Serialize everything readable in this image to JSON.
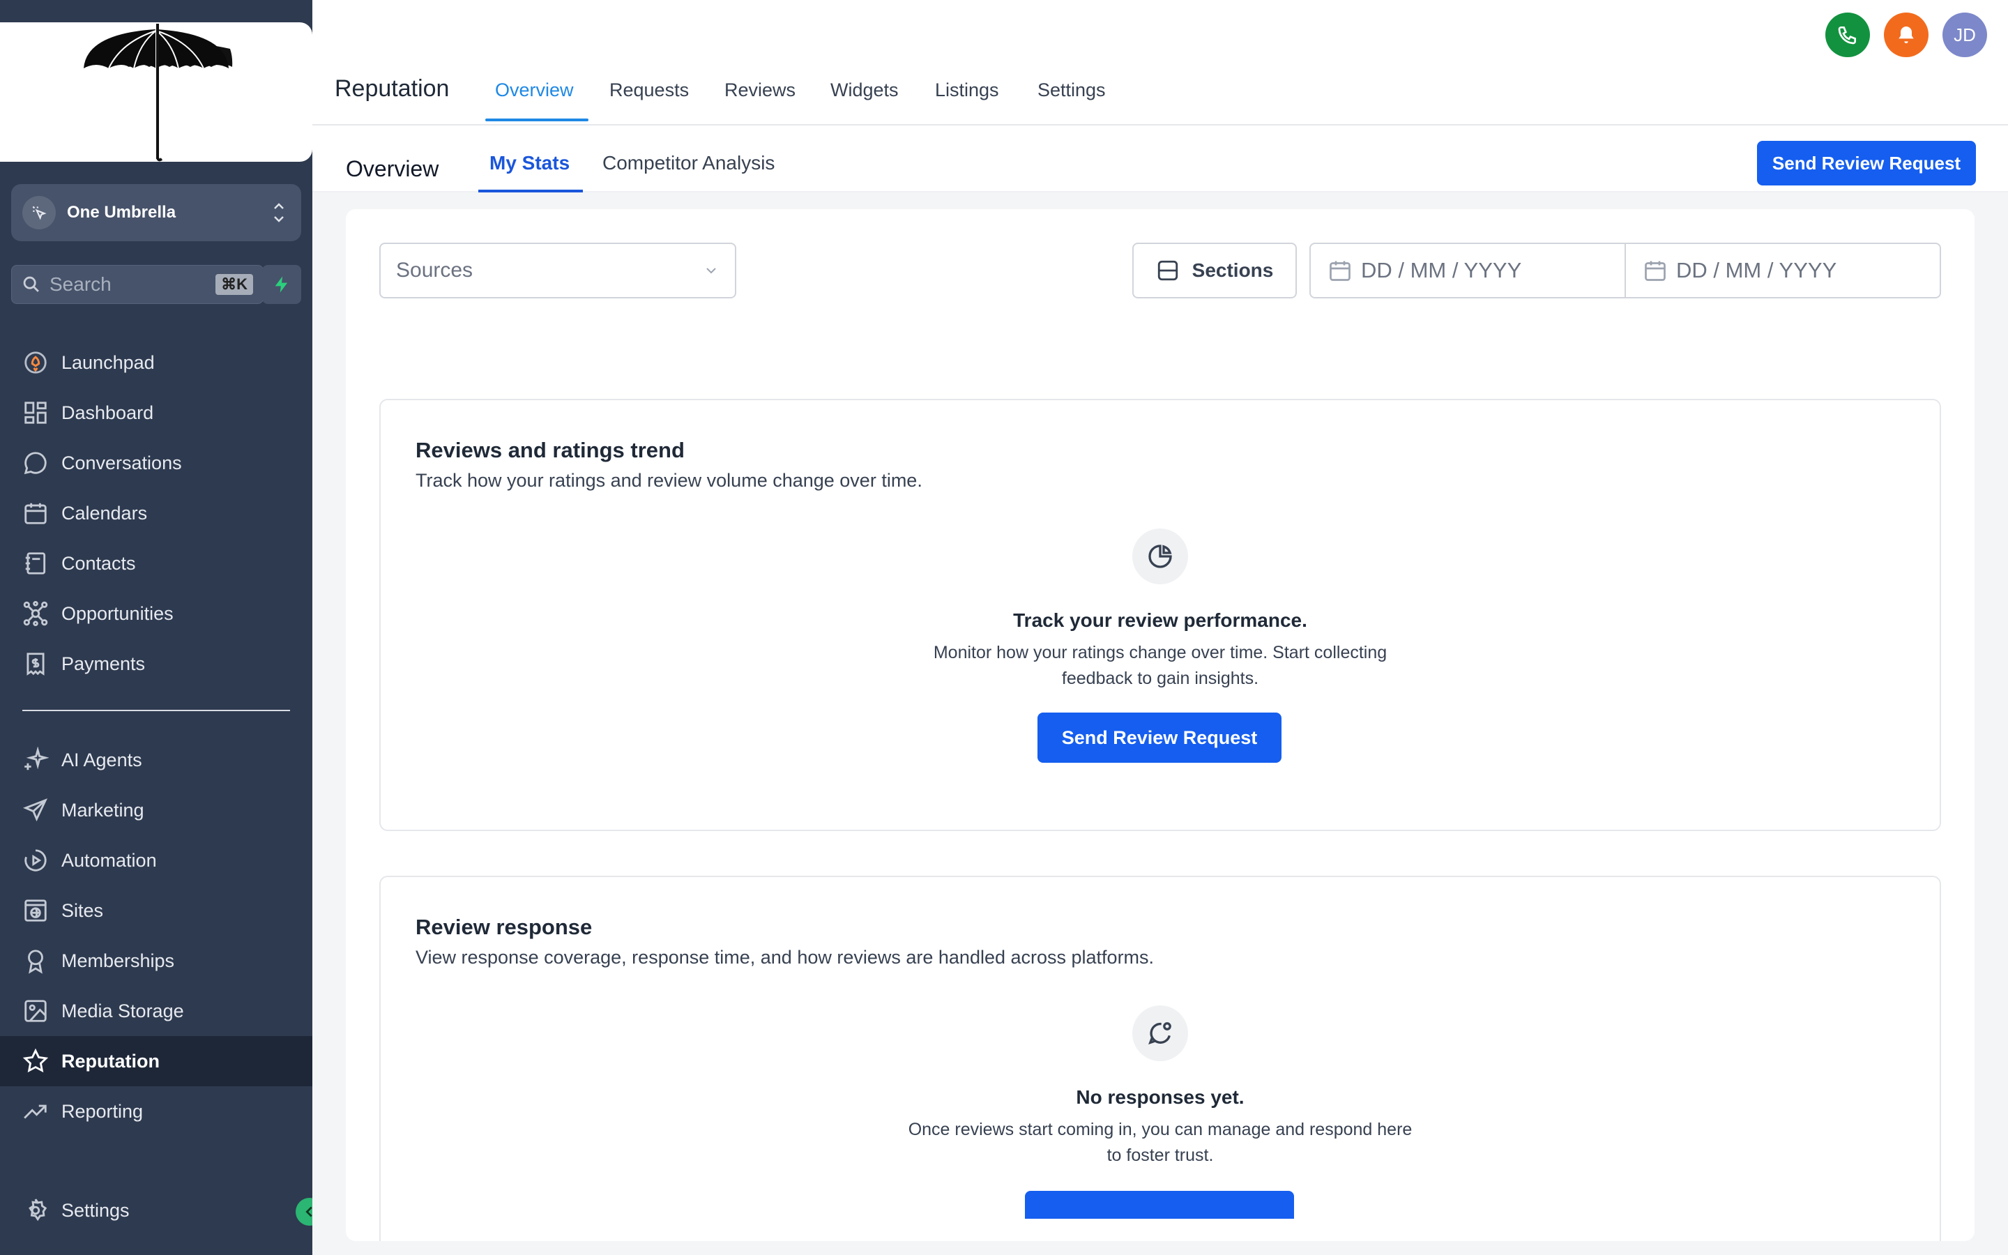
{
  "sidebar": {
    "account": {
      "name": "One Umbrella"
    },
    "search": {
      "placeholder": "Search",
      "shortcut": "⌘K"
    },
    "nav_primary": [
      {
        "label": "Launchpad",
        "icon": "rocket-icon"
      },
      {
        "label": "Dashboard",
        "icon": "grid-icon"
      },
      {
        "label": "Conversations",
        "icon": "chat-bubble-icon"
      },
      {
        "label": "Calendars",
        "icon": "calendar-icon"
      },
      {
        "label": "Contacts",
        "icon": "address-book-icon"
      },
      {
        "label": "Opportunities",
        "icon": "network-icon"
      },
      {
        "label": "Payments",
        "icon": "receipt-icon"
      }
    ],
    "nav_secondary": [
      {
        "label": "AI Agents",
        "icon": "sparkle-icon"
      },
      {
        "label": "Marketing",
        "icon": "send-icon"
      },
      {
        "label": "Automation",
        "icon": "play-circle-icon"
      },
      {
        "label": "Sites",
        "icon": "globe-window-icon"
      },
      {
        "label": "Memberships",
        "icon": "award-icon"
      },
      {
        "label": "Media Storage",
        "icon": "image-icon"
      },
      {
        "label": "Reputation",
        "icon": "star-icon",
        "active": true
      },
      {
        "label": "Reporting",
        "icon": "trend-up-icon"
      }
    ],
    "settings_label": "Settings"
  },
  "header": {
    "title": "Reputation",
    "tabs": [
      "Overview",
      "Requests",
      "Reviews",
      "Widgets",
      "Listings",
      "Settings"
    ],
    "active_tab": "Overview",
    "avatar_initials": "JD",
    "colors": {
      "phone": "#12923f",
      "bell": "#f26b1d",
      "avatar": "#7c88c9",
      "accent": "#1e88e5"
    }
  },
  "subheader": {
    "title": "Overview",
    "tabs": [
      "My Stats",
      "Competitor Analysis"
    ],
    "active_tab": "My Stats",
    "cta": "Send Review Request"
  },
  "filters": {
    "sources_placeholder": "Sources",
    "sections_label": "Sections",
    "date_from_placeholder": "DD / MM / YYYY",
    "date_to_placeholder": "DD / MM / YYYY"
  },
  "cards": [
    {
      "title": "Reviews and ratings trend",
      "description": "Track how your ratings and review volume change over time.",
      "empty_title": "Track your review performance.",
      "empty_line1": "Monitor how your ratings change over time. Start collecting",
      "empty_line2": "feedback to gain insights.",
      "button": "Send Review Request"
    },
    {
      "title": "Review response",
      "description": "View response coverage, response time, and how reviews are handled across platforms.",
      "empty_title": "No responses yet.",
      "empty_line1": "Once reviews start coming in, you can manage and respond here",
      "empty_line2": "to foster trust."
    }
  ]
}
